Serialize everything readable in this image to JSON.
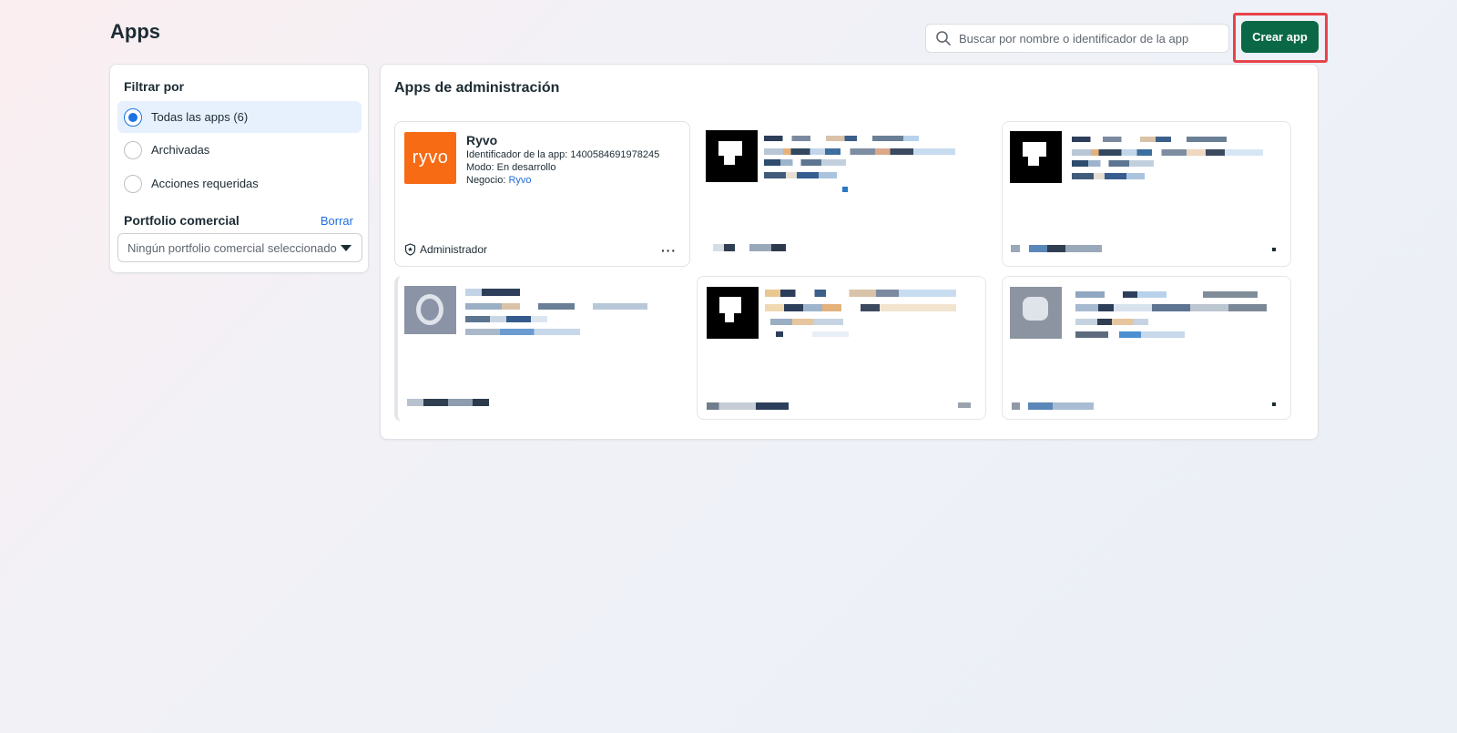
{
  "header": {
    "title": "Apps",
    "search_placeholder": "Buscar por nombre o identificador de la app",
    "search_value": "",
    "create_button": "Crear app"
  },
  "filters": {
    "title": "Filtrar por",
    "options": [
      {
        "label": "Todas las apps (6)",
        "selected": true
      },
      {
        "label": "Archivadas",
        "selected": false
      },
      {
        "label": "Acciones requeridas",
        "selected": false
      }
    ],
    "portfolio_title": "Portfolio comercial",
    "clear_label": "Borrar",
    "portfolio_select": "Ningún portfolio comercial seleccionado"
  },
  "main": {
    "title": "Apps de administración",
    "app": {
      "logo_text": "ryvo",
      "name": "Ryvo",
      "id_text": "Identificador de la app: 1400584691978245",
      "mode_text": "Modo: En desarrollo",
      "business_label": "Negocio: ",
      "business_link": "Ryvo",
      "role": "Administrador",
      "more": "···"
    }
  },
  "colors": {
    "accent": "#0a6847",
    "highlight": "#e8424b",
    "link": "#216fdb",
    "logo": "#f76b15"
  }
}
